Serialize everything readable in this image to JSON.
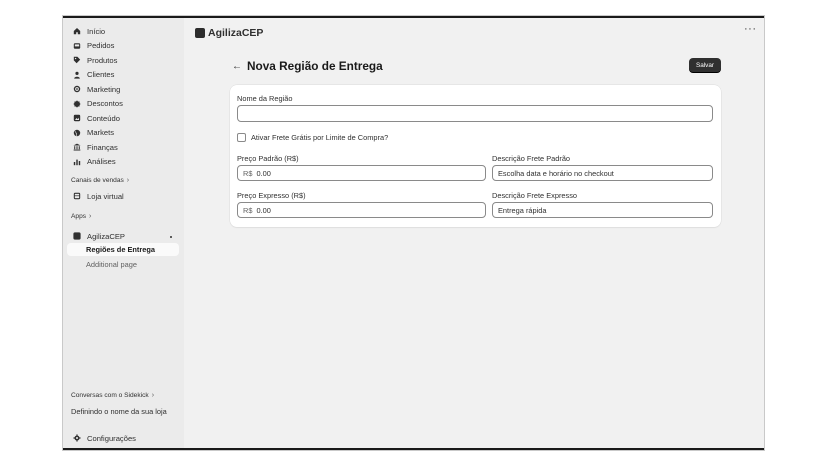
{
  "sidebar": {
    "items": [
      {
        "label": "Início",
        "icon": "home-icon"
      },
      {
        "label": "Pedidos",
        "icon": "inbox-icon"
      },
      {
        "label": "Produtos",
        "icon": "tag-icon"
      },
      {
        "label": "Clientes",
        "icon": "person-icon"
      },
      {
        "label": "Marketing",
        "icon": "target-icon"
      },
      {
        "label": "Descontos",
        "icon": "discount-icon"
      },
      {
        "label": "Conteúdo",
        "icon": "content-icon"
      },
      {
        "label": "Markets",
        "icon": "globe-icon"
      },
      {
        "label": "Finanças",
        "icon": "bank-icon"
      },
      {
        "label": "Análises",
        "icon": "chart-icon"
      }
    ],
    "sales_channels_title": "Canais de vendas",
    "online_store_label": "Loja virtual",
    "apps_title": "Apps",
    "app_name": "AgilizaCEP",
    "app_subitems": [
      "Regiões de Entrega",
      "Additional page"
    ],
    "sidekick_title": "Conversas com o Sidekick",
    "sidekick_item": "Definindo o nome da sua loja",
    "settings_label": "Configurações"
  },
  "header": {
    "app_title": "AgilizaCEP",
    "more_label": "···"
  },
  "page": {
    "title": "Nova Região de Entrega",
    "back_label": "←",
    "save_label": "Salvar"
  },
  "form": {
    "region_name_label": "Nome da Região",
    "region_name_value": "",
    "free_shipping_label": "Ativar Frete Grátis por Limite de Compra?",
    "free_shipping_checked": false,
    "standard_price_label": "Preço Padrão (R$)",
    "standard_price_prefix": "R$",
    "standard_price_value": "0.00",
    "standard_desc_label": "Descrição Frete Padrão",
    "standard_desc_value": "Escolha data e horário no checkout",
    "express_price_label": "Preço Expresso (R$)",
    "express_price_prefix": "R$",
    "express_price_value": "0.00",
    "express_desc_label": "Descrição Frete Expresso",
    "express_desc_value": "Entrega rápida"
  }
}
